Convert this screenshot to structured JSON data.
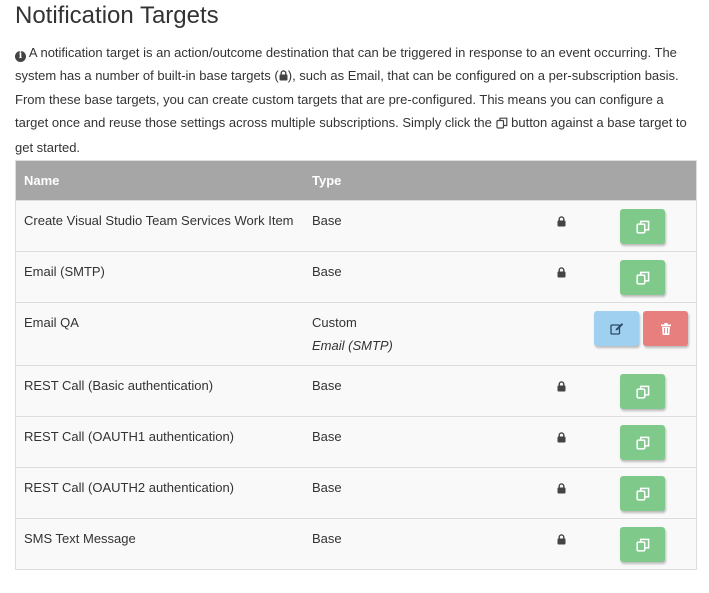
{
  "page": {
    "title": "Notification Targets",
    "intro_part1": "A notification target is an action/outcome destination that can be triggered in response to an event occurring. The system has a number of built-in base targets (",
    "intro_part2": "), such as Email, that can be configured on a per-subscription basis. From these base targets, you can create custom targets that are pre-configured. This means you can configure a target once and reuse those settings across multiple subscriptions. Simply click the ",
    "intro_part3": " button against a base target to get started."
  },
  "table": {
    "headers": {
      "name": "Name",
      "type": "Type"
    },
    "rows": [
      {
        "name": "Create Visual Studio Team Services Work Item",
        "type": "Base",
        "subtype": "",
        "locked": true
      },
      {
        "name": "Email (SMTP)",
        "type": "Base",
        "subtype": "",
        "locked": true
      },
      {
        "name": "Email QA",
        "type": "Custom",
        "subtype": "Email (SMTP)",
        "locked": false
      },
      {
        "name": "REST Call (Basic authentication)",
        "type": "Base",
        "subtype": "",
        "locked": true
      },
      {
        "name": "REST Call (OAUTH1 authentication)",
        "type": "Base",
        "subtype": "",
        "locked": true
      },
      {
        "name": "REST Call (OAUTH2 authentication)",
        "type": "Base",
        "subtype": "",
        "locked": true
      },
      {
        "name": "SMS Text Message",
        "type": "Base",
        "subtype": "",
        "locked": true
      }
    ]
  },
  "icons": {
    "info": "info-circle-icon",
    "lock": "lock-icon",
    "copy": "copy-icon",
    "edit": "edit-icon",
    "delete": "trash-icon"
  },
  "colors": {
    "header_bg": "#a6a6a6",
    "copy_button": "#7fc98b",
    "edit_button": "#9fd0ef",
    "delete_button": "#e77f7f"
  }
}
